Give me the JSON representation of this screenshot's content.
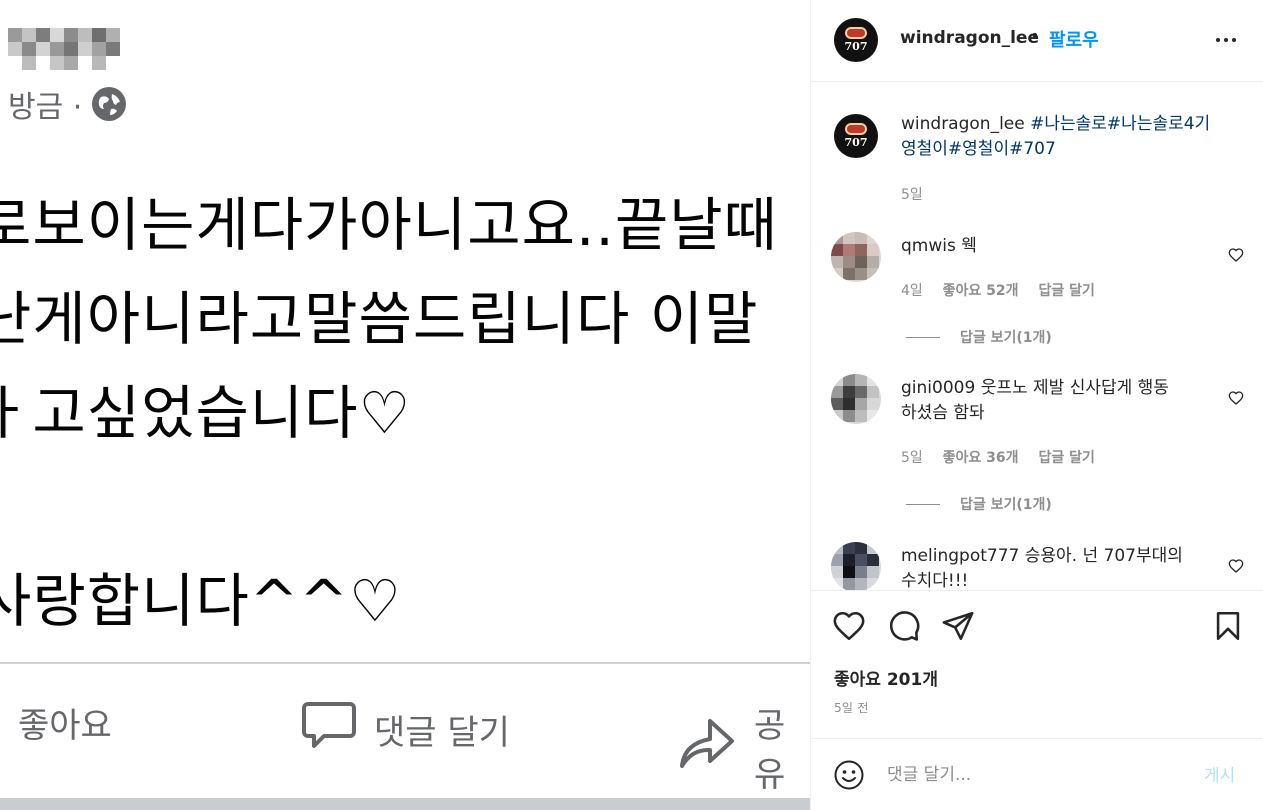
{
  "post_image": {
    "author_blurred": true,
    "meta_time": "방금 ·",
    "globe_icon": "globe-icon",
    "body_lines": [
      "로보이는게다가아니고요..끝날때",
      "난게아니라고말씀드립니다 이말",
      "ㅏ고싶었습니다♡",
      "",
      "사랑합니다^^♡"
    ],
    "actions": {
      "like": "좋아요",
      "comment": "댓글 달기",
      "share": "공유"
    }
  },
  "header": {
    "username": "windragon_lee",
    "dot": "•",
    "follow": "팔로우",
    "more_icon": "more-icon",
    "avatar_text": "707"
  },
  "caption": {
    "username": "windragon_lee",
    "text_part1": "#나는솔로#나는솔로4기",
    "text_part2": "영철이#영철이#707",
    "time": "5일"
  },
  "comments": [
    {
      "username": "qmwis",
      "text": "웩",
      "time": "4일",
      "likes": "좋아요 52개",
      "reply": "답글 달기",
      "view_replies": "답글 보기(1개)"
    },
    {
      "username": "gini0009",
      "text_line1": "웃프노 제발 신사답게 행동",
      "text_line2": "하셨슴 함돠",
      "time": "5일",
      "likes": "좋아요 36개",
      "reply": "답글 달기",
      "view_replies": "답글 보기(1개)"
    },
    {
      "username": "melingpot777",
      "text_line1": "승용아. 넌 707부대의",
      "text_line2": "수치다!!!"
    }
  ],
  "actions": {
    "like_icon": "heart-icon",
    "comment_icon": "comment-icon",
    "share_icon": "send-icon",
    "save_icon": "bookmark-icon",
    "likes": "좋아요 201개",
    "time": "5일 전"
  },
  "add_comment": {
    "emoji_icon": "emoji-icon",
    "placeholder": "댓글 달기...",
    "post": "게시"
  },
  "colors": {
    "accent": "#0095f6",
    "hashtag": "#00376b",
    "muted": "#8e8e8e",
    "post_disabled": "#b2dffc"
  }
}
